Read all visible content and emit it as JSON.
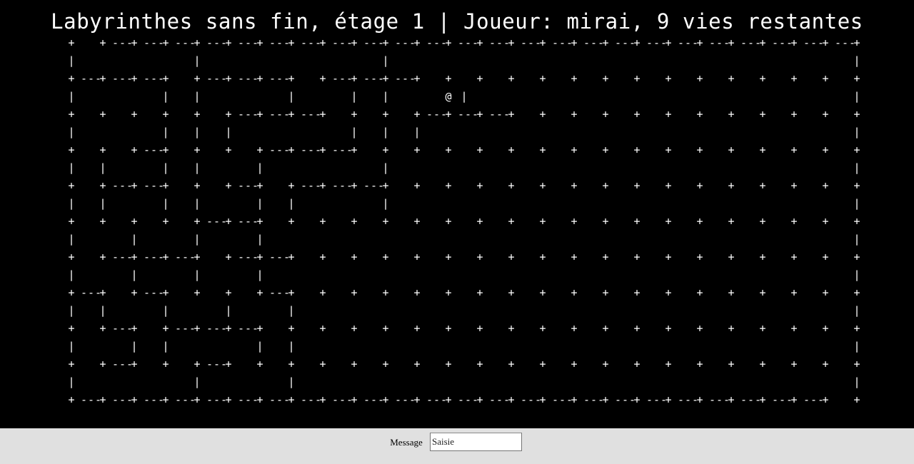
{
  "header": {
    "title": "Labyrinthes sans fin, étage 1 | Joueur: mirai, 9 vies restantes"
  },
  "maze": {
    "player_glyph": "@",
    "rows": [
      "+   +---+---+---+---+---+---+---+---+---+---+---+---+---+---+---+---+---+---+---+---+---+---+---+---+",
      "|               |                       |                                                           |",
      "+---+---+---+   +---+---+---+   +---+---+---+   +   +   +   +   +   +   +   +   +   +   +   +   +   +",
      "|           |   |           |       |   |       @ |                                                 |",
      "+   +   +   +   +   +---+---+---+   +   +   +---+---+---+   +   +   +   +   +   +   +   +   +   +   +",
      "|           |   |   |               |   |   |                                                       |",
      "+   +   +---+   +   +   +---+---+---+   +   +   +   +   +   +   +   +   +   +   +   +   +   +   +   +",
      "|   |       |   |       |               |                                                           |",
      "+   +---+---+   +   +---+   +---+---+---+   +   +   +   +   +   +   +   +   +   +   +   +   +   +   +",
      "|   |       |   |       |   |           |                                                           |",
      "+   +   +   +   +---+---+   +   +   +   +   +   +   +   +   +   +   +   +   +   +   +   +   +   +   +",
      "|       |       |       |                                                                           |",
      "+   +---+---+---+   +---+---+   +   +   +   +   +   +   +   +   +   +   +   +   +   +   +   +   +   +",
      "|       |       |       |                                                                           |",
      "+---+   +---+   +   +   +---+   +   +   +   +   +   +   +   +   +   +   +   +   +   +   +   +   +   +",
      "|   |       |       |       |                                                                       |",
      "+   +---+   +---+---+---+   +   +   +   +   +   +   +   +   +   +   +   +   +   +   +   +   +   +   +",
      "|       |   |           |   |                                                                       |",
      "+   +---+   +   +---+   +   +   +   +   +   +   +   +   +   +   +   +   +   +   +   +   +   +   +   +",
      "|               |           |                                                                       |",
      "+---+---+---+---+---+---+---+---+---+---+---+---+---+---+---+---+---+---+---+---+---+---+---+---+   +"
    ]
  },
  "footer": {
    "message_label": "Message",
    "input_placeholder": "Saisie",
    "input_value": ""
  }
}
